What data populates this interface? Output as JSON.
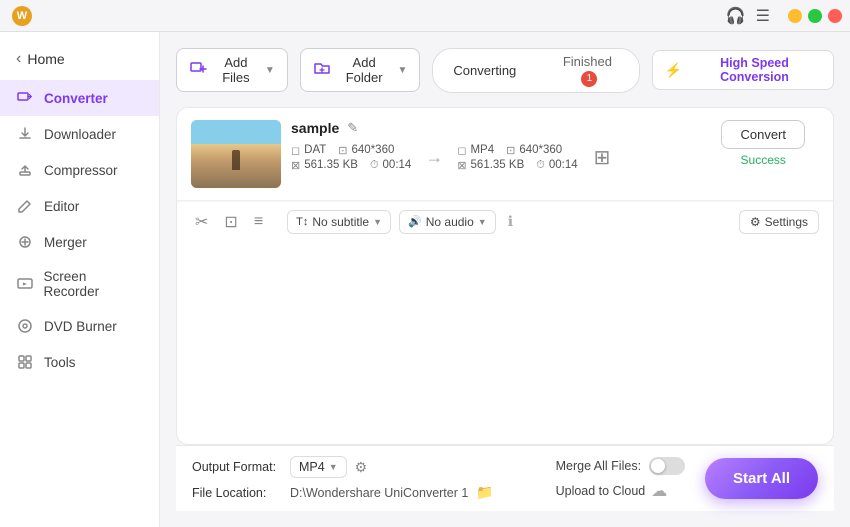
{
  "titlebar": {
    "app_icon_label": "W",
    "minimize_label": "—",
    "maximize_label": "□",
    "close_label": "✕"
  },
  "sidebar": {
    "home_label": "Home",
    "items": [
      {
        "id": "converter",
        "label": "Converter",
        "icon": "⊞",
        "active": true
      },
      {
        "id": "downloader",
        "label": "Downloader",
        "icon": "↓"
      },
      {
        "id": "compressor",
        "label": "Compressor",
        "icon": "⤓"
      },
      {
        "id": "editor",
        "label": "Editor",
        "icon": "✏"
      },
      {
        "id": "merger",
        "label": "Merger",
        "icon": "⊕"
      },
      {
        "id": "screen-recorder",
        "label": "Screen Recorder",
        "icon": "⊡"
      },
      {
        "id": "dvd-burner",
        "label": "DVD Burner",
        "icon": "⊙"
      },
      {
        "id": "tools",
        "label": "Tools",
        "icon": "⊞"
      }
    ]
  },
  "toolbar": {
    "add_file_label": "Add Files",
    "add_folder_label": "Add Folder"
  },
  "tabs": {
    "converting_label": "Converting",
    "finished_label": "Finished",
    "badge_count": "1"
  },
  "high_speed": {
    "label": "High Speed Conversion"
  },
  "file_item": {
    "name": "sample",
    "source": {
      "format": "DAT",
      "resolution": "640*360",
      "size": "561.35 KB",
      "duration": "00:14"
    },
    "target": {
      "format": "MP4",
      "resolution": "640*360",
      "size": "561.35 KB",
      "duration": "00:14"
    },
    "convert_btn_label": "Convert",
    "success_label": "Success",
    "subtitle_label": "No subtitle",
    "audio_label": "No audio",
    "settings_label": "Settings"
  },
  "bottom_bar": {
    "output_format_label": "Output Format:",
    "output_format_value": "MP4",
    "file_location_label": "File Location:",
    "file_location_value": "D:\\Wondershare UniConverter 1",
    "merge_files_label": "Merge All Files:",
    "upload_cloud_label": "Upload to Cloud",
    "start_all_label": "Start All"
  }
}
